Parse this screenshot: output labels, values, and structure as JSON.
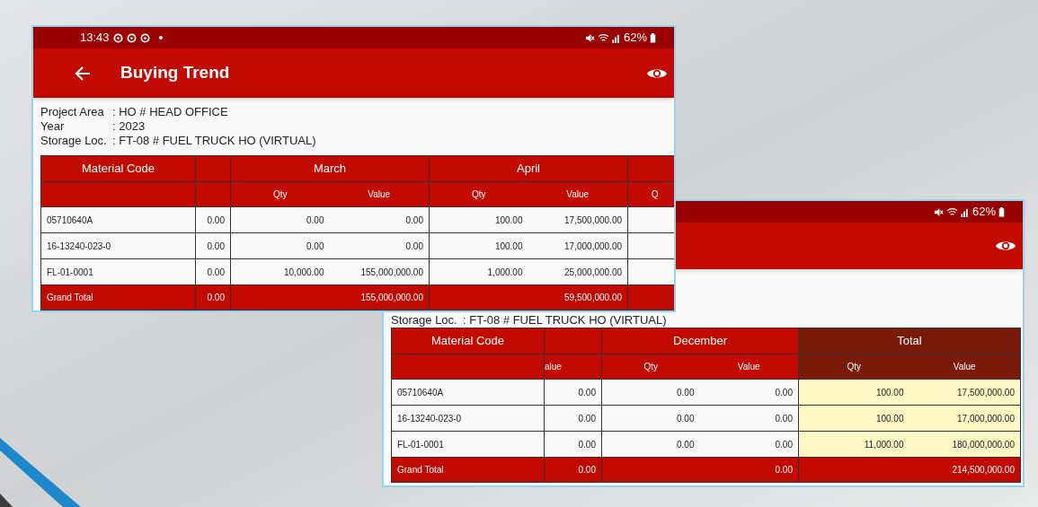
{
  "screenshots": [
    {
      "status_bar": {
        "time": "13:43",
        "battery": "62%"
      },
      "app_bar": {
        "title": "Buying Trend"
      },
      "info": [
        {
          "label": "Project Area",
          "value": ": HO # HEAD OFFICE"
        },
        {
          "label": "Year",
          "value": ": 2023"
        },
        {
          "label": "Storage Loc.",
          "value": ": FT-08 # FUEL TRUCK HO (VIRTUAL)"
        }
      ],
      "table": {
        "groups": [
          {
            "kind": "code",
            "header": "Material Code"
          },
          {
            "kind": "single"
          },
          {
            "kind": "period",
            "header": "March",
            "sub": [
              "Qty",
              "Value"
            ]
          },
          {
            "kind": "period",
            "header": "April",
            "sub": [
              "Qty",
              "Value"
            ]
          },
          {
            "kind": "cut",
            "sub": [
              "Q"
            ]
          }
        ],
        "rows": [
          {
            "cells": [
              "05710640A",
              "0.00",
              "0.00",
              "0.00",
              "100.00",
              "17,500,000.00"
            ]
          },
          {
            "cells": [
              "16-13240-023-0",
              "0.00",
              "0.00",
              "0.00",
              "100.00",
              "17,000,000.00"
            ]
          },
          {
            "cells": [
              "FL-01-0001",
              "0.00",
              "10,000.00",
              "155,000,000.00",
              "1,000.00",
              "25,000,000.00"
            ]
          }
        ],
        "grand_total": {
          "label": "Grand Total",
          "cells": [
            "0.00",
            "155,000,000.00",
            "59,500,000.00"
          ]
        }
      }
    },
    {
      "status_bar": {
        "battery": "62%"
      },
      "info": [
        {
          "label": "Storage Loc.",
          "value": ": FT-08 # FUEL TRUCK HO (VIRTUAL)"
        }
      ],
      "table": {
        "groups": [
          {
            "kind": "code",
            "header": "Material Code"
          },
          {
            "kind": "single",
            "sub": [
              "alue"
            ]
          },
          {
            "kind": "period",
            "header": "December",
            "sub": [
              "Qty",
              "Value"
            ]
          },
          {
            "kind": "total",
            "header": "Total",
            "sub": [
              "Qty",
              "Value"
            ]
          }
        ],
        "rows": [
          {
            "cells": [
              "05710640A",
              "0.00",
              "0.00",
              "0.00",
              "100.00",
              "17,500,000.00"
            ]
          },
          {
            "cells": [
              "16-13240-023-0",
              "0.00",
              "0.00",
              "0.00",
              "100.00",
              "17,000,000.00"
            ]
          },
          {
            "cells": [
              "FL-01-0001",
              "0.00",
              "0.00",
              "0.00",
              "11,000.00",
              "180,000,000.00"
            ]
          }
        ],
        "grand_total": {
          "label": "Grand Total",
          "cells": [
            "0.00",
            "0.00",
            "214,500,000.00"
          ]
        }
      }
    }
  ]
}
